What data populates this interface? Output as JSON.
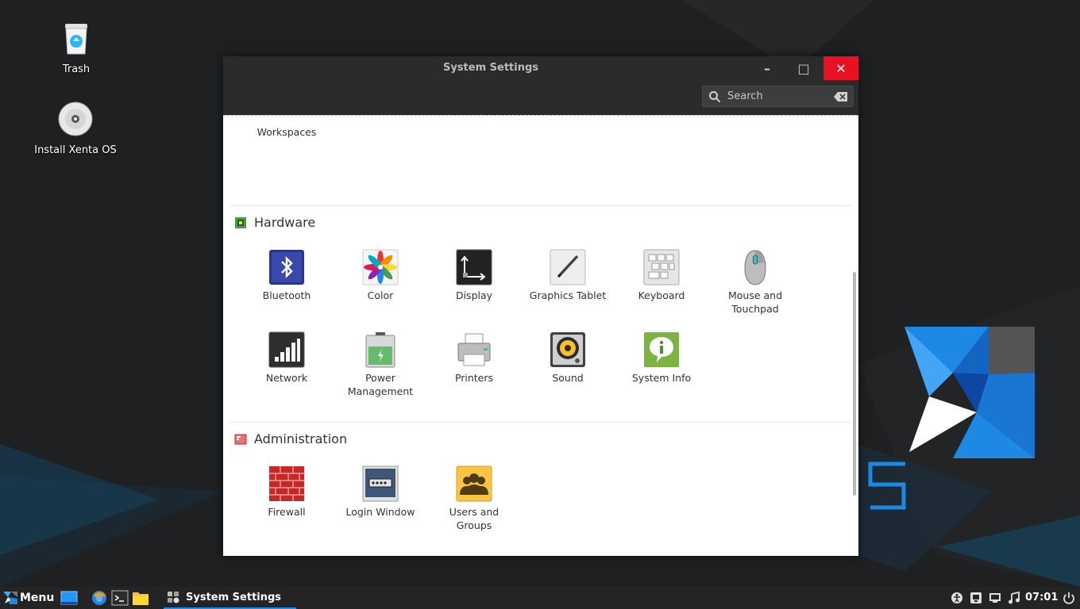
{
  "desktop": {
    "icons": [
      {
        "label": "Trash",
        "icon": "trash-icon"
      },
      {
        "label": "Install Xenta OS",
        "icon": "cd-install-icon"
      }
    ],
    "wallpaper_accent": "#1e88e5"
  },
  "window": {
    "title": "System Settings",
    "controls": {
      "minimize": "–",
      "maximize": "□",
      "close": "✕"
    },
    "search": {
      "placeholder": "Search"
    },
    "partial_item": {
      "label": "Workspaces",
      "icon": "workspaces-icon"
    },
    "sections": [
      {
        "title": "Hardware",
        "icon": "hardware-chip-icon",
        "items": [
          {
            "label": "Bluetooth",
            "icon": "bluetooth-icon"
          },
          {
            "label": "Color",
            "icon": "color-icon"
          },
          {
            "label": "Display",
            "icon": "display-icon"
          },
          {
            "label": "Graphics Tablet",
            "icon": "graphics-tablet-icon"
          },
          {
            "label": "Keyboard",
            "icon": "keyboard-icon"
          },
          {
            "label": "Mouse and Touchpad",
            "icon": "mouse-icon"
          },
          {
            "label": "Network",
            "icon": "network-icon"
          },
          {
            "label": "Power Management",
            "icon": "battery-icon"
          },
          {
            "label": "Printers",
            "icon": "printer-icon"
          },
          {
            "label": "Sound",
            "icon": "speaker-icon"
          },
          {
            "label": "System Info",
            "icon": "system-info-icon"
          }
        ]
      },
      {
        "title": "Administration",
        "icon": "administration-icon",
        "items": [
          {
            "label": "Firewall",
            "icon": "firewall-icon"
          },
          {
            "label": "Login Window",
            "icon": "login-window-icon"
          },
          {
            "label": "Users and Groups",
            "icon": "users-groups-icon"
          }
        ]
      }
    ]
  },
  "taskbar": {
    "menu_label": "Menu",
    "active_task": "System Settings",
    "clock": "07:01",
    "tray": [
      "accessibility-icon",
      "display-tray-icon",
      "network-tray-icon",
      "music-icon",
      "power-icon"
    ]
  }
}
